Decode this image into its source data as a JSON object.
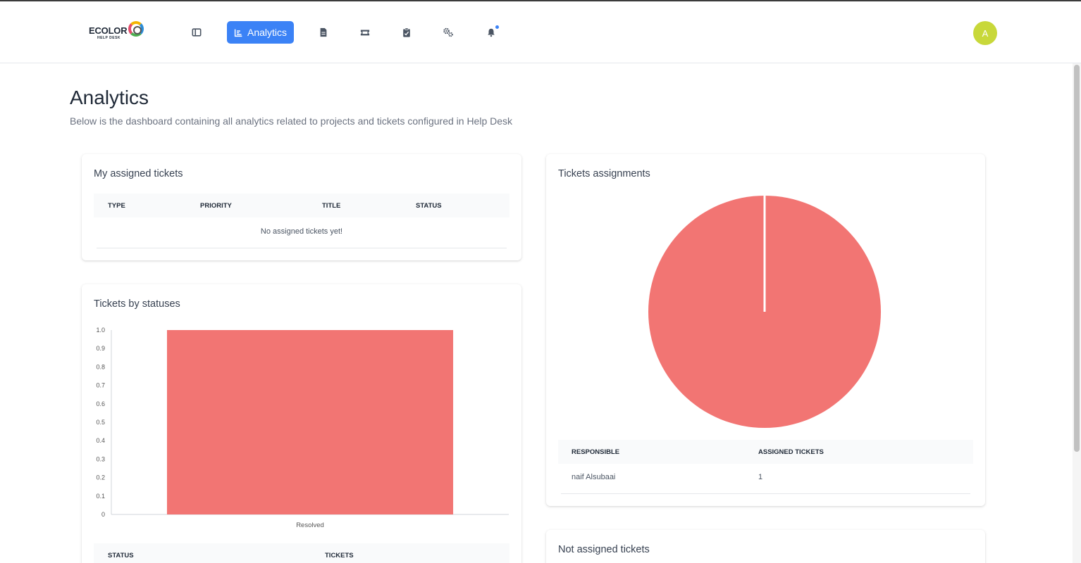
{
  "app": {
    "logo_text": "ECOLOR",
    "logo_sub": "HELP DESK"
  },
  "nav": {
    "active_label": "Analytics",
    "items": [
      "dashboard-icon",
      "analytics-icon",
      "document-icon",
      "ticket-icon",
      "clipboard-icon",
      "gears-icon",
      "bell-icon"
    ]
  },
  "user": {
    "avatar_initial": "A"
  },
  "page": {
    "title": "Analytics",
    "subtitle": "Below is the dashboard containing all analytics related to projects and tickets configured in Help Desk"
  },
  "my_tickets": {
    "title": "My assigned tickets",
    "columns": [
      "TYPE",
      "PRIORITY",
      "TITLE",
      "STATUS"
    ],
    "empty_text": "No assigned tickets yet!"
  },
  "statuses": {
    "title": "Tickets by statuses",
    "table_columns": [
      "STATUS",
      "TICKETS"
    ]
  },
  "assignments": {
    "title": "Tickets assignments",
    "columns": [
      "RESPONSIBLE",
      "ASSIGNED TICKETS"
    ],
    "rows": [
      {
        "responsible": "naif Alsubaai",
        "count": "1"
      }
    ]
  },
  "not_assigned": {
    "title": "Not assigned tickets"
  },
  "colors": {
    "accent": "#3b82f6",
    "chart": "#f27573",
    "avatar": "#c8d83a"
  },
  "chart_data": [
    {
      "type": "bar",
      "categories": [
        "Resolved"
      ],
      "values": [
        1
      ],
      "ylim": [
        0,
        1.0
      ],
      "yticks": [
        "0",
        "0.1",
        "0.2",
        "0.3",
        "0.4",
        "0.5",
        "0.6",
        "0.7",
        "0.8",
        "0.9",
        "1.0"
      ],
      "grid": false
    },
    {
      "type": "pie",
      "labels": [
        "naif Alsubaai"
      ],
      "values": [
        1
      ]
    }
  ]
}
